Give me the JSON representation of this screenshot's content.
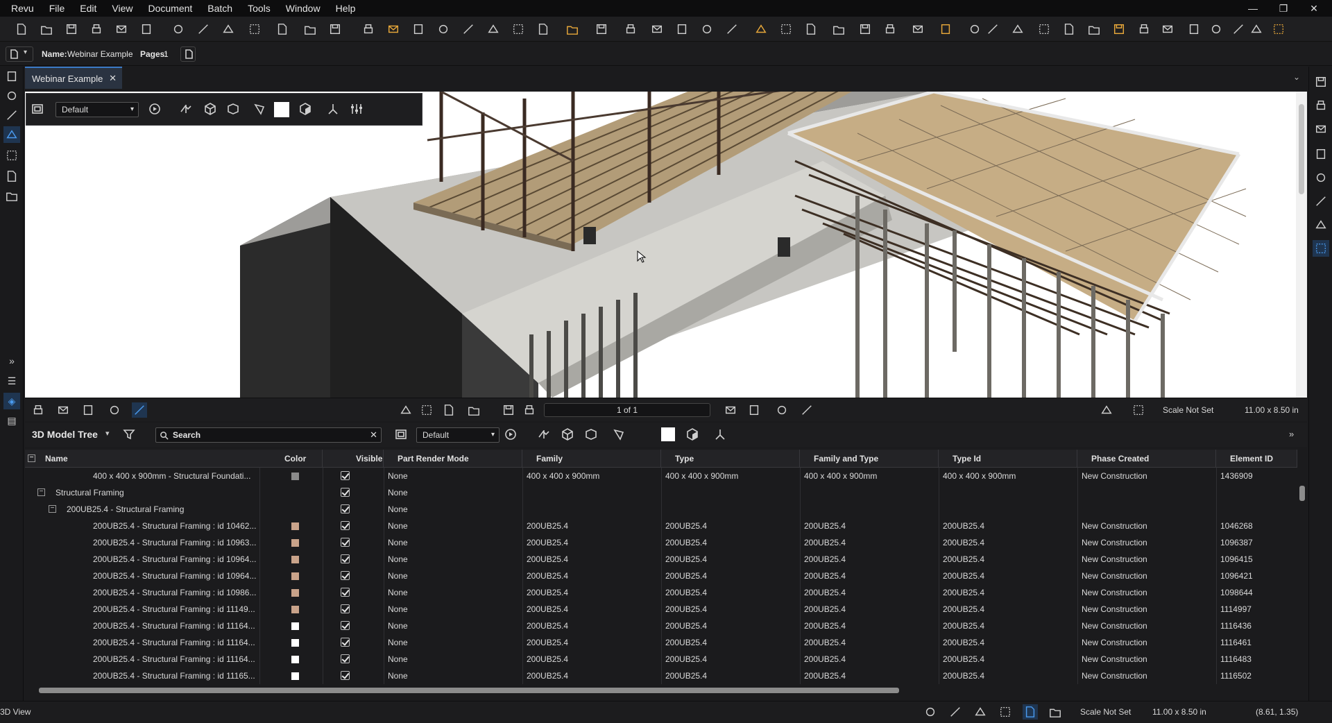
{
  "app": {
    "name": "Revu"
  },
  "menu": [
    "Revu",
    "File",
    "Edit",
    "View",
    "Document",
    "Batch",
    "Tools",
    "Window",
    "Help"
  ],
  "window_controls": {
    "minimize": "—",
    "restore": "❐",
    "close": "✕"
  },
  "propbar": {
    "name_label": "Name:",
    "name_value": "Webinar Example",
    "pages_label": "Pages:",
    "pages_value": "1"
  },
  "tab": {
    "title": "Webinar Example",
    "close": "✕"
  },
  "viewtools": {
    "view_preset": "Default"
  },
  "nav": {
    "page_indicator": "1 of 1",
    "scale": "Scale Not Set",
    "page_size": "11.00 x 8.50 in"
  },
  "tree": {
    "title": "3D Model Tree",
    "search_placeholder": "Search",
    "view_preset": "Default",
    "columns": [
      "Name",
      "Color",
      "Visible",
      "Part Render Mode",
      "Family",
      "Type",
      "Family and Type",
      "Type Id",
      "Phase Created",
      "Element ID"
    ],
    "rows": [
      {
        "indent": 3,
        "name": "400 x 400 x 900mm - Structural Foundati...",
        "color": "#8a8a8a",
        "mode": "None",
        "family": "400 x 400 x 900mm",
        "type": "400 x 400 x 900mm",
        "family_type": "400 x 400 x 900mm",
        "type_id": "400 x 400 x 900mm",
        "phase": "New Construction",
        "element_id": "1436909"
      },
      {
        "indent": 1,
        "expander": "−",
        "name": "Structural Framing",
        "color": "",
        "mode": "None",
        "family": "",
        "type": "",
        "family_type": "",
        "type_id": "",
        "phase": "",
        "element_id": ""
      },
      {
        "indent": 2,
        "expander": "−",
        "name": "200UB25.4 - Structural Framing",
        "color": "",
        "mode": "None",
        "family": "",
        "type": "",
        "family_type": "",
        "type_id": "",
        "phase": "",
        "element_id": ""
      },
      {
        "indent": 3,
        "name": "200UB25.4 - Structural Framing : id 10462...",
        "color": "#c9a38a",
        "mode": "None",
        "family": "200UB25.4",
        "type": "200UB25.4",
        "family_type": "200UB25.4",
        "type_id": "200UB25.4",
        "phase": "New Construction",
        "element_id": "1046268"
      },
      {
        "indent": 3,
        "name": "200UB25.4 - Structural Framing : id 10963...",
        "color": "#c9a38a",
        "mode": "None",
        "family": "200UB25.4",
        "type": "200UB25.4",
        "family_type": "200UB25.4",
        "type_id": "200UB25.4",
        "phase": "New Construction",
        "element_id": "1096387"
      },
      {
        "indent": 3,
        "name": "200UB25.4 - Structural Framing : id 10964...",
        "color": "#c9a38a",
        "mode": "None",
        "family": "200UB25.4",
        "type": "200UB25.4",
        "family_type": "200UB25.4",
        "type_id": "200UB25.4",
        "phase": "New Construction",
        "element_id": "1096415"
      },
      {
        "indent": 3,
        "name": "200UB25.4 - Structural Framing : id 10964...",
        "color": "#c9a38a",
        "mode": "None",
        "family": "200UB25.4",
        "type": "200UB25.4",
        "family_type": "200UB25.4",
        "type_id": "200UB25.4",
        "phase": "New Construction",
        "element_id": "1096421"
      },
      {
        "indent": 3,
        "name": "200UB25.4 - Structural Framing : id 10986...",
        "color": "#c9a38a",
        "mode": "None",
        "family": "200UB25.4",
        "type": "200UB25.4",
        "family_type": "200UB25.4",
        "type_id": "200UB25.4",
        "phase": "New Construction",
        "element_id": "1098644"
      },
      {
        "indent": 3,
        "name": "200UB25.4 - Structural Framing : id 11149...",
        "color": "#c9a38a",
        "mode": "None",
        "family": "200UB25.4",
        "type": "200UB25.4",
        "family_type": "200UB25.4",
        "type_id": "200UB25.4",
        "phase": "New Construction",
        "element_id": "1114997"
      },
      {
        "indent": 3,
        "name": "200UB25.4 - Structural Framing : id 11164...",
        "color": "#ffffff",
        "mode": "None",
        "family": "200UB25.4",
        "type": "200UB25.4",
        "family_type": "200UB25.4",
        "type_id": "200UB25.4",
        "phase": "New Construction",
        "element_id": "1116436"
      },
      {
        "indent": 3,
        "name": "200UB25.4 - Structural Framing : id 11164...",
        "color": "#ffffff",
        "mode": "None",
        "family": "200UB25.4",
        "type": "200UB25.4",
        "family_type": "200UB25.4",
        "type_id": "200UB25.4",
        "phase": "New Construction",
        "element_id": "1116461"
      },
      {
        "indent": 3,
        "name": "200UB25.4 - Structural Framing : id 11164...",
        "color": "#ffffff",
        "mode": "None",
        "family": "200UB25.4",
        "type": "200UB25.4",
        "family_type": "200UB25.4",
        "type_id": "200UB25.4",
        "phase": "New Construction",
        "element_id": "1116483"
      },
      {
        "indent": 3,
        "name": "200UB25.4 - Structural Framing : id 11165...",
        "color": "#ffffff",
        "mode": "None",
        "family": "200UB25.4",
        "type": "200UB25.4",
        "family_type": "200UB25.4",
        "type_id": "200UB25.4",
        "phase": "New Construction",
        "element_id": "1116502"
      }
    ]
  },
  "status": {
    "mode": "3D View",
    "scale": "Scale Not Set",
    "page_size": "11.00 x 8.50 in",
    "coords": "(8.61, 1.35)"
  },
  "colors": {
    "accent": "#3a79c5",
    "background": "#1b1b1d"
  }
}
